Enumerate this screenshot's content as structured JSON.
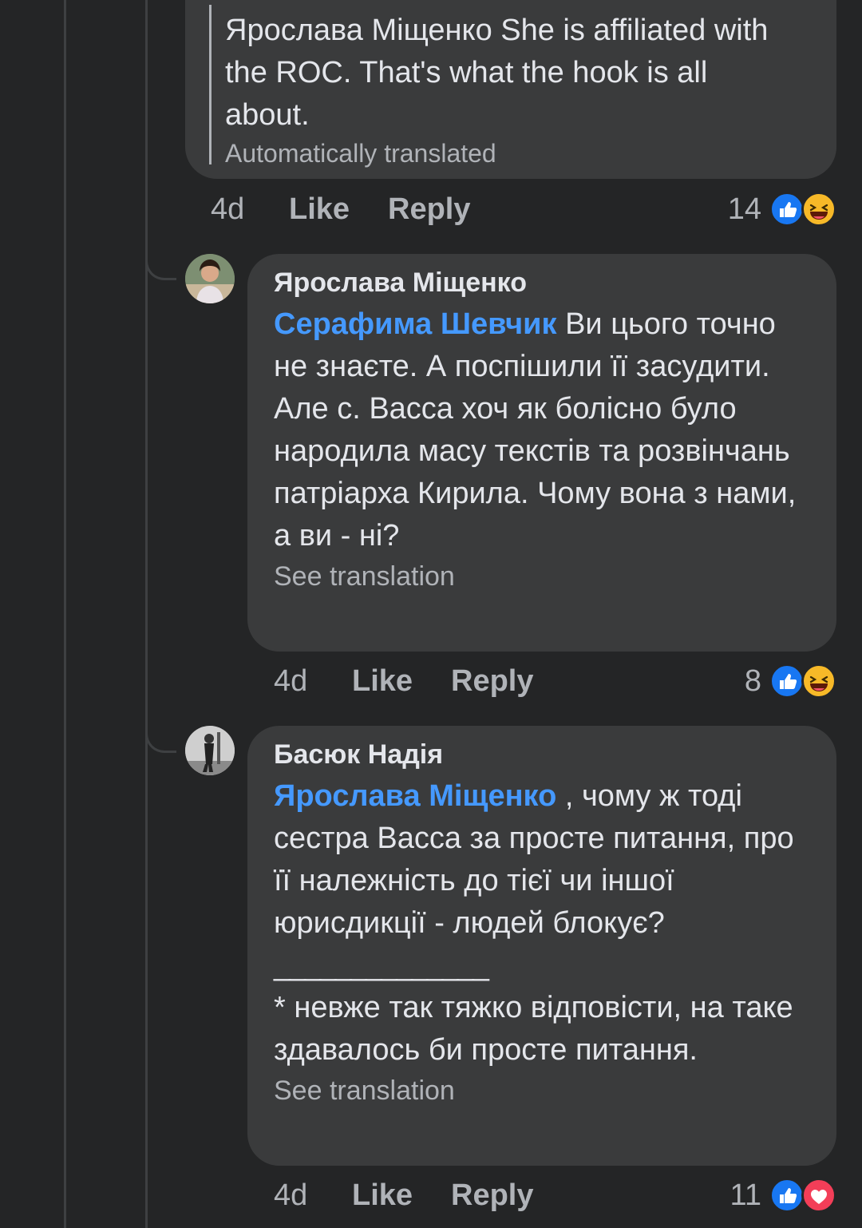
{
  "comment_1": {
    "text": "Ярослава Міщенко She is affiliated with the ROC. That's what the hook is all about.",
    "translation_note": "Automatically translated",
    "time": "4d",
    "like_label": "Like",
    "reply_label": "Reply",
    "reaction_count": "14",
    "reactions": [
      "like-icon",
      "haha-icon"
    ]
  },
  "comment_2": {
    "author": "Ярослава Міщенко",
    "mention": "Серафима Шевчик",
    "text": " Ви цього точно не знаєте. А поспішили її засудити. Але с. Васса хоч як болісно було народила масу текстів та розвінчань патріарха Кирила. Чому вона з нами, а ви - ні?",
    "translation_link": "See translation",
    "time": "4d",
    "like_label": "Like",
    "reply_label": "Reply",
    "reaction_count": "8",
    "reactions": [
      "like-icon",
      "haha-icon"
    ]
  },
  "comment_3": {
    "author": "Басюк Надія",
    "mention": "Ярослава Міщенко",
    "text": " , чому ж тоді сестра Васса за просте питання, про її належність до тієї чи іншої юрисдикції - людей блокує?",
    "divider": "______________",
    "text_2": "* невже так тяжко відповісти, на таке здавалось би просте питання.",
    "translation_link": "See translation",
    "time": "4d",
    "like_label": "Like",
    "reply_label": "Reply",
    "reaction_count": "11",
    "reactions": [
      "like-icon",
      "love-icon"
    ]
  },
  "colors": {
    "background": "#242526",
    "bubble": "#3a3b3c",
    "mention": "#4599ff",
    "like": "#1877f2",
    "haha": "#f7b928",
    "love": "#f33e58"
  }
}
